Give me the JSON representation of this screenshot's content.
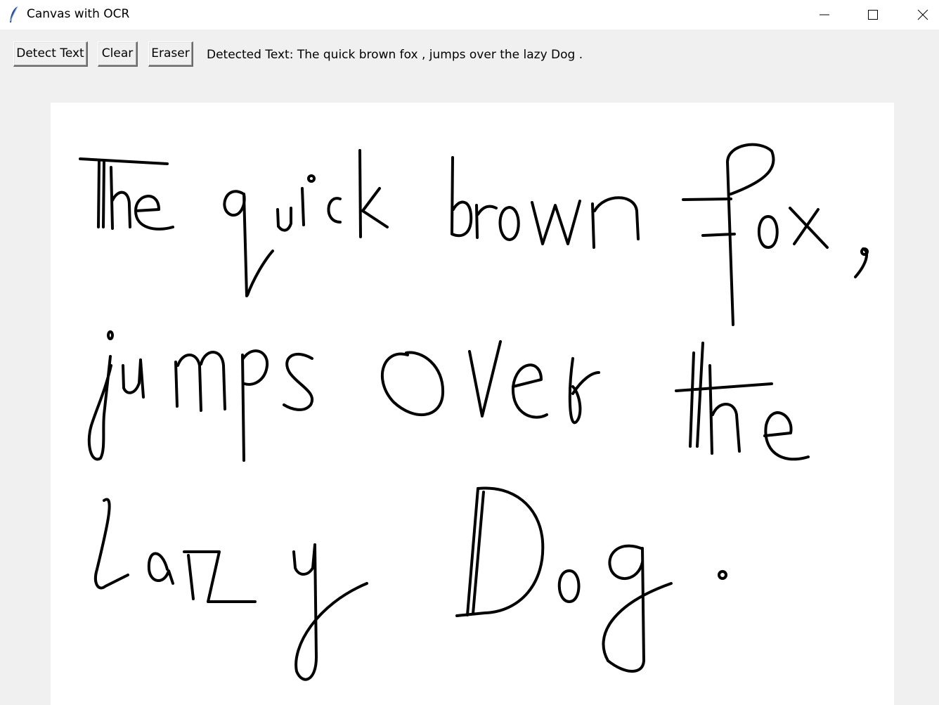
{
  "window": {
    "title": "Canvas with OCR",
    "icon": "feather-icon",
    "controls": [
      "minimize-icon",
      "maximize-icon",
      "close-icon"
    ]
  },
  "toolbar": {
    "detect_label": "Detect Text",
    "clear_label": "Clear",
    "eraser_label": "Eraser",
    "status_text": "Detected Text: The quick brown fox , jumps over the lazy Dog ."
  },
  "canvas": {
    "background": "#ffffff",
    "stroke_color": "#000000",
    "handwritten_content": "The quick brown fox, jumps over the lazy Dog."
  }
}
